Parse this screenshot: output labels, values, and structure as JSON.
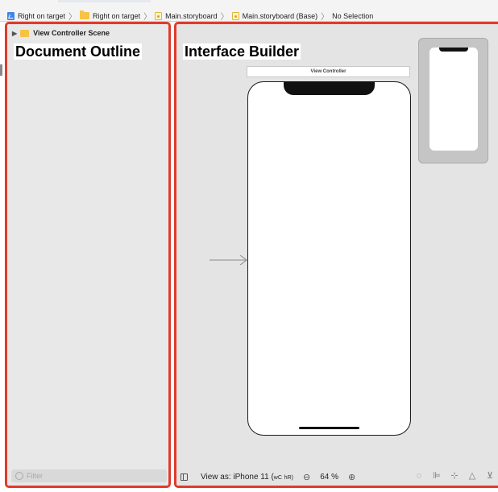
{
  "breadcrumbs": [
    {
      "label": "Right on target",
      "icon": "project-icon"
    },
    {
      "label": "Right on target",
      "icon": "folder-icon"
    },
    {
      "label": "Main.storyboard",
      "icon": "storyboard-file-icon"
    },
    {
      "label": "Main.storyboard (Base)",
      "icon": "storyboard-file-icon"
    },
    {
      "label": "No Selection",
      "icon": ""
    }
  ],
  "outline": {
    "annotation": "Document Outline",
    "scene_label": "View Controller Scene",
    "filter_placeholder": "Filter"
  },
  "canvas": {
    "annotation": "Interface Builder",
    "vc_title": "View Controller"
  },
  "bottom_bar": {
    "view_as": "View as: iPhone 11 (",
    "wc": "wC",
    "hr": "hR)",
    "zoom": "64 %"
  },
  "colors": {
    "highlight_border": "#e03b2c"
  }
}
